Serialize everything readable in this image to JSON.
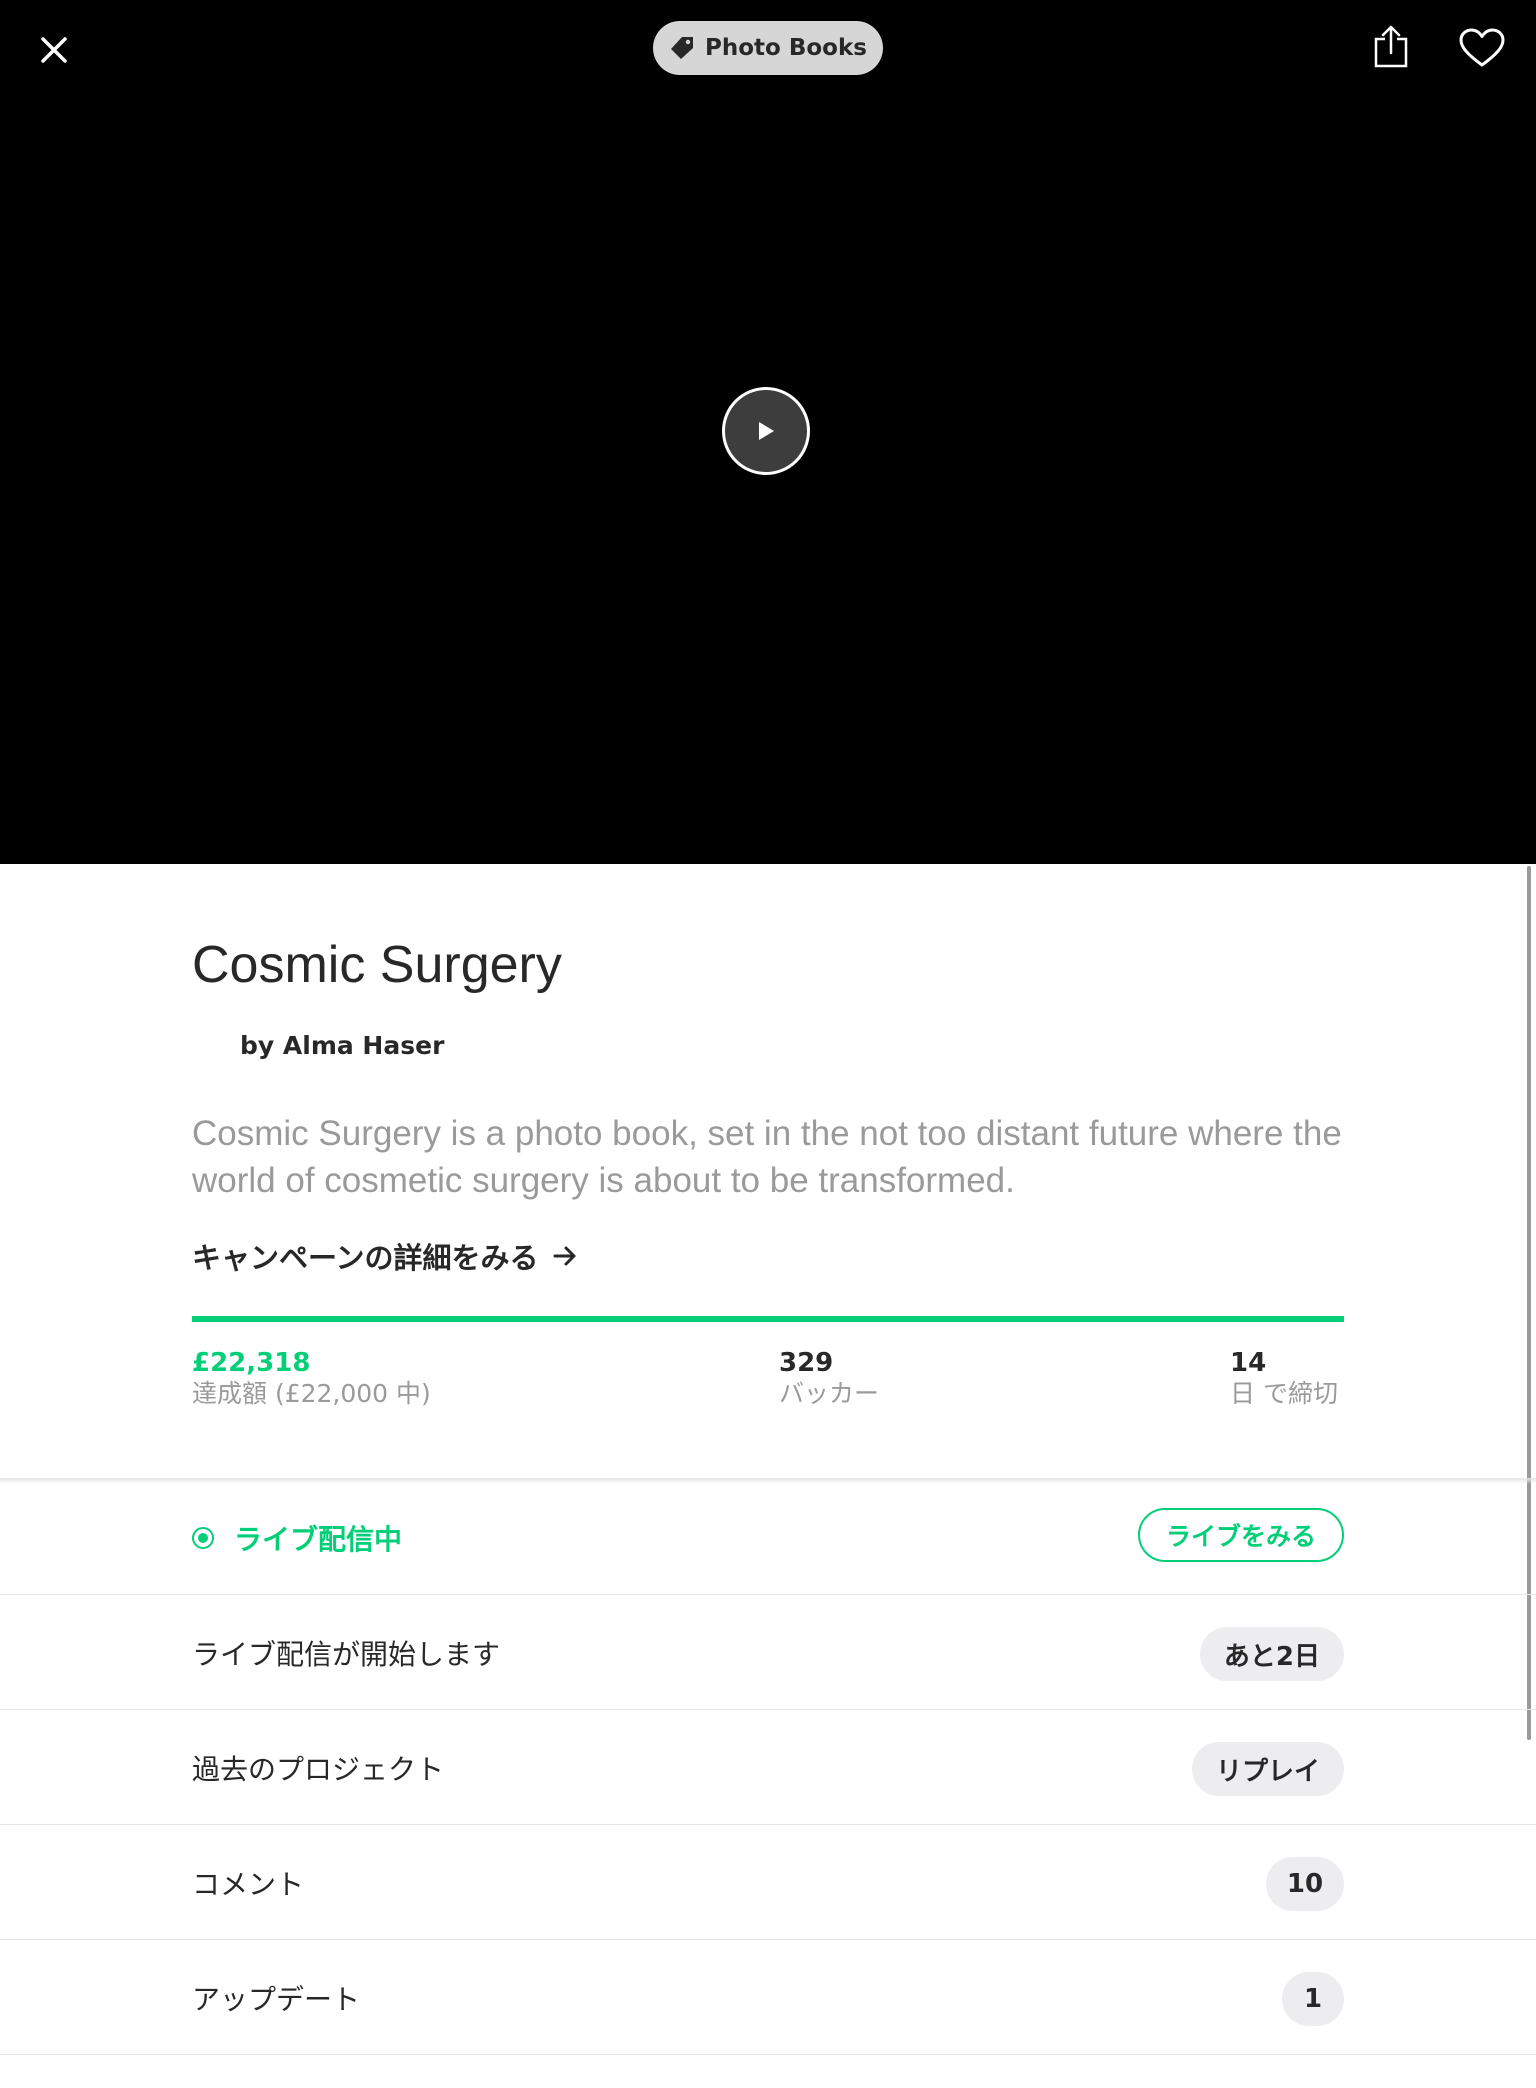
{
  "header": {
    "category": "Photo Books",
    "close_icon": "close-icon",
    "share_icon": "share-icon",
    "heart_icon": "heart-icon"
  },
  "video": {
    "play_icon": "play-icon"
  },
  "project": {
    "title": "Cosmic Surgery",
    "creator": "by Alma Haser",
    "blurb": "Cosmic Surgery is a photo book, set in the not too distant future where the world of cosmetic surgery is about to be transformed.",
    "details_link": "キャンペーンの詳細をみる"
  },
  "stats": {
    "progress_fraction": 1.0,
    "pledged_value": "£22,318",
    "pledged_label": "達成額 (£22,000 中)",
    "backers_value": "329",
    "backers_label": "バッカー",
    "days_value": "14",
    "days_label": "日 で締切"
  },
  "rows": {
    "live_label": "ライブ配信中",
    "live_button": "ライブをみる",
    "upcoming_label": "ライブ配信が開始します",
    "upcoming_badge": "あと2日",
    "past_label": "過去のプロジェクト",
    "past_badge": "リプレイ",
    "comments_label": "コメント",
    "comments_count": "10",
    "updates_label": "アップデート",
    "updates_count": "1"
  },
  "colors": {
    "accent_green": "#05ce78",
    "text_dark": "#282828",
    "text_muted": "#9a9a9a",
    "pill_bg": "#ededf0"
  }
}
